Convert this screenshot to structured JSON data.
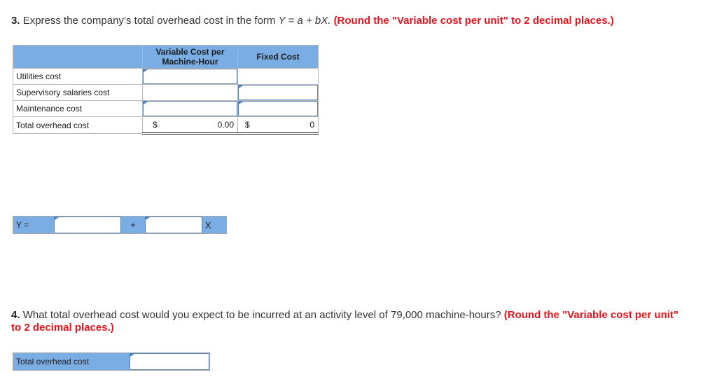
{
  "question3": {
    "number": "3.",
    "text": "Express the company’s total overhead cost in the form",
    "formula": "Y = a + bX.",
    "instruction": "(Round the \"Variable cost per unit\" to 2 decimal places.)"
  },
  "table": {
    "headers": [
      "",
      "Variable Cost per Machine-Hour",
      "Fixed Cost"
    ],
    "rows": [
      {
        "label": "Utilities cost",
        "variable": "",
        "fixed": ""
      },
      {
        "label": "Supervisory salaries cost",
        "variable": "",
        "fixed": ""
      },
      {
        "label": "Maintenance cost",
        "variable": "",
        "fixed": ""
      }
    ],
    "total": {
      "label": "Total overhead cost",
      "variable_currency": "$",
      "variable_value": "0.00",
      "fixed_currency": "$",
      "fixed_value": "0"
    }
  },
  "equation": {
    "y_label": "Y =",
    "a_value": "",
    "plus_label": "+",
    "b_value": "",
    "x_label": "X"
  },
  "question4": {
    "number": "4.",
    "text": "What total overhead cost would you expect to be incurred at an activity level of 79,000 machine-hours?",
    "instruction": "(Round the \"Variable cost per unit\" to 2 decimal places.)"
  },
  "answer4": {
    "label": "Total overhead cost",
    "value": ""
  }
}
